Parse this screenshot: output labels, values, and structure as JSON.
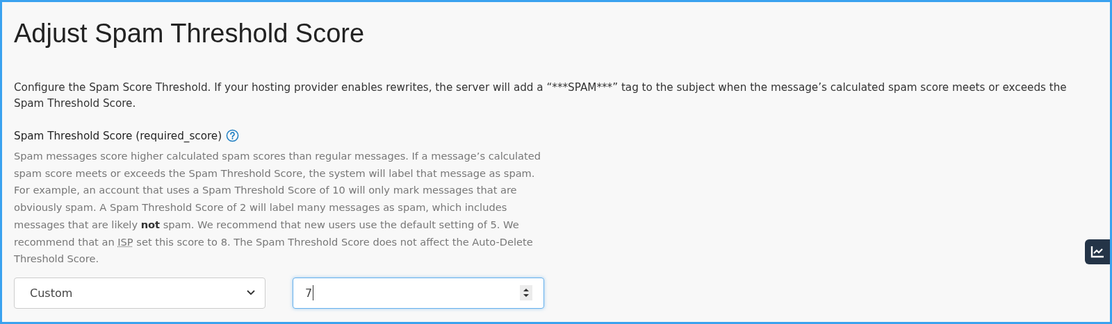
{
  "title": "Adjust Spam Threshold Score",
  "description": "Configure the Spam Score Threshold. If your hosting provider enables rewrites, the server will add a “***SPAM***” tag to the subject when the message’s calculated spam score meets or exceeds the Spam Threshold Score.",
  "field": {
    "label": "Spam Threshold Score (required_score)",
    "help_before": "Spam messages score higher calculated spam scores than regular messages. If a message’s calculated spam score meets or exceeds the Spam Threshold Score, the system will label that message as spam. For example, an account that uses a Spam Threshold Score of 10 will only mark messages that are obviously spam. A Spam Threshold Score of 2 will label many messages as spam, which includes messages that are likely **not** spam. We recommend that new users use the default setting of 5. We recommend that an",
    "abbr": "ISP",
    "help_after": "set this score to 8. The Spam Threshold Score does not affect the Auto-Delete Threshold Score.",
    "select_value": "Custom",
    "input_value": "7"
  }
}
